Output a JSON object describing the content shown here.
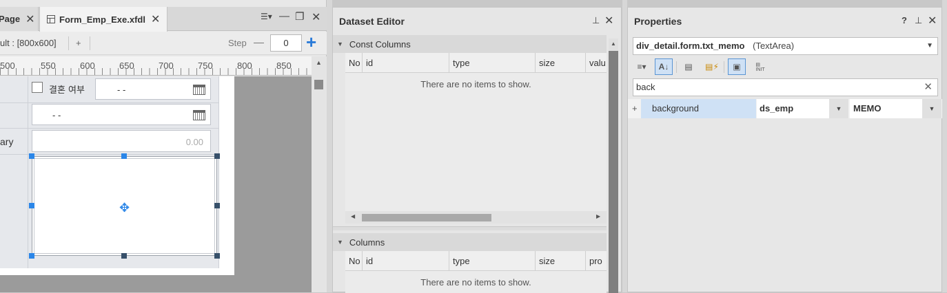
{
  "form_editor": {
    "tabs": [
      {
        "label": "Page",
        "active": false
      },
      {
        "label": "Form_Emp_Exe.xfdl",
        "active": true
      }
    ],
    "toolbar": {
      "resolution_label": "ult : [800x600]",
      "add_label": "+",
      "step_label": "Step",
      "step_value": "0"
    },
    "ruler_labels": [
      "500",
      "550",
      "600",
      "650",
      "700",
      "750",
      "800",
      "850"
    ],
    "form": {
      "marriage_checkbox_label": "결혼 여부",
      "date_placeholder_1": "-   -",
      "date_placeholder_2": "-   -",
      "salary_label": "ary",
      "salary_value": "0.00"
    }
  },
  "dataset_editor": {
    "title": "Dataset Editor",
    "const_columns": {
      "title": "Const Columns",
      "headers": [
        "No",
        "id",
        "type",
        "size",
        "valu"
      ],
      "empty_message": "There are no items to show."
    },
    "columns": {
      "title": "Columns",
      "headers": [
        "No",
        "id",
        "type",
        "size",
        "pro"
      ],
      "empty_message": "There are no items to show."
    }
  },
  "properties": {
    "title": "Properties",
    "help_label": "?",
    "object_name": "div_detail.form.txt_memo",
    "object_type": "(TextArea)",
    "search_value": "back",
    "rows": [
      {
        "expand": "+",
        "name": "background",
        "dataset": "ds_emp",
        "column": "MEMO"
      }
    ]
  },
  "colors": {
    "accent": "#2b86e8",
    "selected_row": "#cfe1f5"
  }
}
